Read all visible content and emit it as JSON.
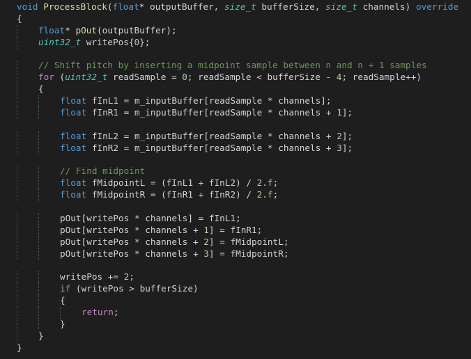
{
  "editor": {
    "language": "cpp",
    "colors": {
      "background": "#1e1e1e",
      "keyword": "#569cd6",
      "control": "#c586c0",
      "function": "#dcdcaa",
      "type": "#4ec9b0",
      "number": "#b5cea8",
      "comment": "#6a9955",
      "plain": "#d4d4d4",
      "indent_guide": "#5a5a5a"
    },
    "lines": [
      {
        "indent": 0,
        "tokens": [
          [
            "kw",
            "void"
          ],
          [
            "pl",
            " "
          ],
          [
            "fn",
            "ProcessBlock"
          ],
          [
            "pl",
            "("
          ],
          [
            "kw",
            "float"
          ],
          [
            "pl",
            "* outputBuffer, "
          ],
          [
            "ty",
            "size_t"
          ],
          [
            "pl",
            " bufferSize, "
          ],
          [
            "ty",
            "size_t"
          ],
          [
            "pl",
            " channels) "
          ],
          [
            "kw",
            "override"
          ]
        ]
      },
      {
        "indent": 0,
        "tokens": [
          [
            "pl",
            "{"
          ]
        ]
      },
      {
        "indent": 1,
        "tokens": [
          [
            "kw",
            "float"
          ],
          [
            "pl",
            "* "
          ],
          [
            "fn",
            "pOut"
          ],
          [
            "pl",
            "(outputBuffer);"
          ]
        ]
      },
      {
        "indent": 1,
        "tokens": [
          [
            "ty",
            "uint32_t"
          ],
          [
            "pl",
            " writePos{"
          ],
          [
            "num",
            "0"
          ],
          [
            "pl",
            "};"
          ]
        ]
      },
      {
        "indent": 0,
        "tokens": []
      },
      {
        "indent": 1,
        "tokens": [
          [
            "cmt",
            "// Shift pitch by inserting a midpoint sample between n and n + 1 samples"
          ]
        ]
      },
      {
        "indent": 1,
        "tokens": [
          [
            "ctl",
            "for"
          ],
          [
            "pl",
            " ("
          ],
          [
            "ty",
            "uint32_t"
          ],
          [
            "pl",
            " readSample = "
          ],
          [
            "num",
            "0"
          ],
          [
            "pl",
            "; readSample < bufferSize - "
          ],
          [
            "num",
            "4"
          ],
          [
            "pl",
            "; readSample++)"
          ]
        ]
      },
      {
        "indent": 1,
        "tokens": [
          [
            "pl",
            "{"
          ]
        ]
      },
      {
        "indent": 2,
        "tokens": [
          [
            "kw",
            "float"
          ],
          [
            "pl",
            " fInL1 = m_inputBuffer[readSample * channels];"
          ]
        ]
      },
      {
        "indent": 2,
        "tokens": [
          [
            "kw",
            "float"
          ],
          [
            "pl",
            " fInR1 = m_inputBuffer[readSample * channels + "
          ],
          [
            "num",
            "1"
          ],
          [
            "pl",
            "];"
          ]
        ]
      },
      {
        "indent": 0,
        "tokens": []
      },
      {
        "indent": 2,
        "tokens": [
          [
            "kw",
            "float"
          ],
          [
            "pl",
            " fInL2 = m_inputBuffer[readSample * channels + "
          ],
          [
            "num",
            "2"
          ],
          [
            "pl",
            "];"
          ]
        ]
      },
      {
        "indent": 2,
        "tokens": [
          [
            "kw",
            "float"
          ],
          [
            "pl",
            " fInR2 = m_inputBuffer[readSample * channels + "
          ],
          [
            "num",
            "3"
          ],
          [
            "pl",
            "];"
          ]
        ]
      },
      {
        "indent": 0,
        "tokens": []
      },
      {
        "indent": 2,
        "tokens": [
          [
            "cmt",
            "// Find midpoint"
          ]
        ]
      },
      {
        "indent": 2,
        "tokens": [
          [
            "kw",
            "float"
          ],
          [
            "pl",
            " fMidpointL = (fInL1 + fInL2) / "
          ],
          [
            "num",
            "2.f"
          ],
          [
            "pl",
            ";"
          ]
        ]
      },
      {
        "indent": 2,
        "tokens": [
          [
            "kw",
            "float"
          ],
          [
            "pl",
            " fMidpointR = (fInR1 + fInR2) / "
          ],
          [
            "num",
            "2.f"
          ],
          [
            "pl",
            ";"
          ]
        ]
      },
      {
        "indent": 0,
        "tokens": []
      },
      {
        "indent": 2,
        "tokens": [
          [
            "pl",
            "pOut[writePos * channels] = fInL1;"
          ]
        ]
      },
      {
        "indent": 2,
        "tokens": [
          [
            "pl",
            "pOut[writePos * channels + "
          ],
          [
            "num",
            "1"
          ],
          [
            "pl",
            "] = fInR1;"
          ]
        ]
      },
      {
        "indent": 2,
        "tokens": [
          [
            "pl",
            "pOut[writePos * channels + "
          ],
          [
            "num",
            "2"
          ],
          [
            "pl",
            "] = fMidpointL;"
          ]
        ]
      },
      {
        "indent": 2,
        "tokens": [
          [
            "pl",
            "pOut[writePos * channels + "
          ],
          [
            "num",
            "3"
          ],
          [
            "pl",
            "] = fMidpointR;"
          ]
        ]
      },
      {
        "indent": 0,
        "tokens": []
      },
      {
        "indent": 2,
        "tokens": [
          [
            "pl",
            "writePos += "
          ],
          [
            "num",
            "2"
          ],
          [
            "pl",
            ";"
          ]
        ]
      },
      {
        "indent": 2,
        "tokens": [
          [
            "ctl",
            "if"
          ],
          [
            "pl",
            " (writePos > bufferSize)"
          ]
        ]
      },
      {
        "indent": 2,
        "tokens": [
          [
            "pl",
            "{"
          ]
        ]
      },
      {
        "indent": 3,
        "tokens": [
          [
            "ctl",
            "return"
          ],
          [
            "pl",
            ";"
          ]
        ]
      },
      {
        "indent": 2,
        "tokens": [
          [
            "pl",
            "}"
          ]
        ]
      },
      {
        "indent": 1,
        "tokens": [
          [
            "pl",
            "}"
          ]
        ]
      },
      {
        "indent": 0,
        "tokens": [
          [
            "pl",
            "}"
          ]
        ]
      }
    ]
  }
}
